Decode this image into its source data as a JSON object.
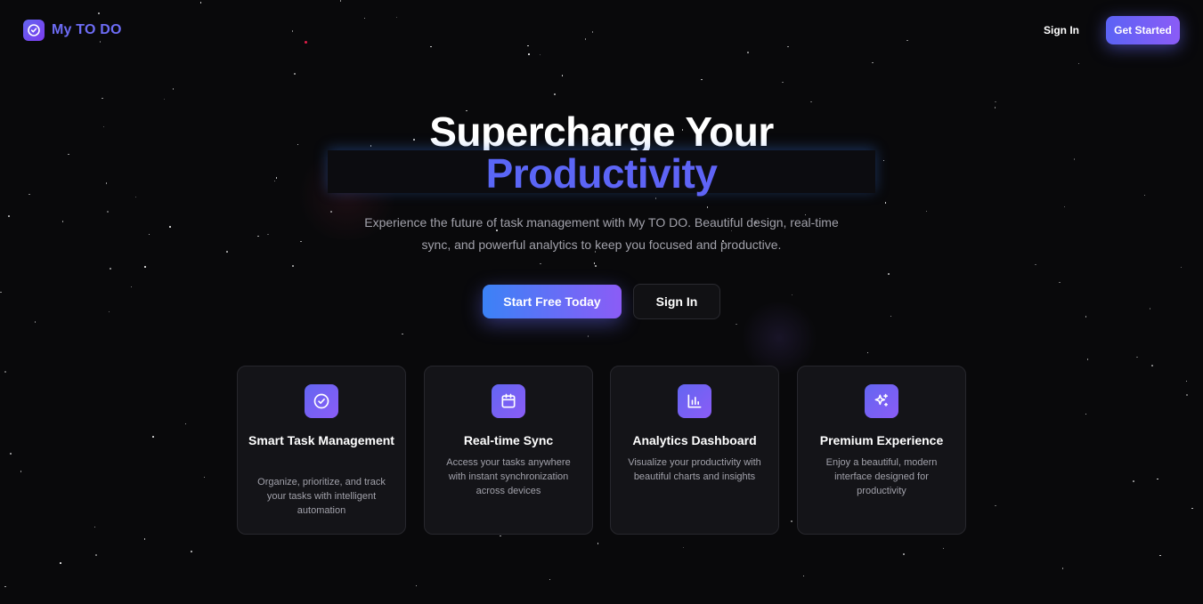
{
  "brand": {
    "name": "My TO DO",
    "accent": "#6d6cf5"
  },
  "nav": {
    "sign_in": "Sign In",
    "get_started": "Get Started"
  },
  "hero": {
    "title_line1": "Supercharge Your",
    "title_line2": "Productivity",
    "subtitle": "Experience the future of task management with My TO DO. Beautiful design, real-time sync, and powerful analytics to keep you focused and productive.",
    "primary_cta": "Start Free Today",
    "secondary_cta": "Sign In"
  },
  "features": [
    {
      "icon": "check-circle-icon",
      "title": "Smart Task Management",
      "description": "Organize, prioritize, and track your tasks with intelligent automation"
    },
    {
      "icon": "calendar-icon",
      "title": "Real-time Sync",
      "description": "Access your tasks anywhere with instant synchronization across devices"
    },
    {
      "icon": "bar-chart-icon",
      "title": "Analytics Dashboard",
      "description": "Visualize your productivity with beautiful charts and insights"
    },
    {
      "icon": "sparkles-icon",
      "title": "Premium Experience",
      "description": "Enjoy a beautiful, modern interface designed for productivity"
    }
  ],
  "colors": {
    "background": "#09090b",
    "gradient_start": "#3b82f6",
    "gradient_end": "#8b5cf6",
    "card_bg": "#141418"
  }
}
